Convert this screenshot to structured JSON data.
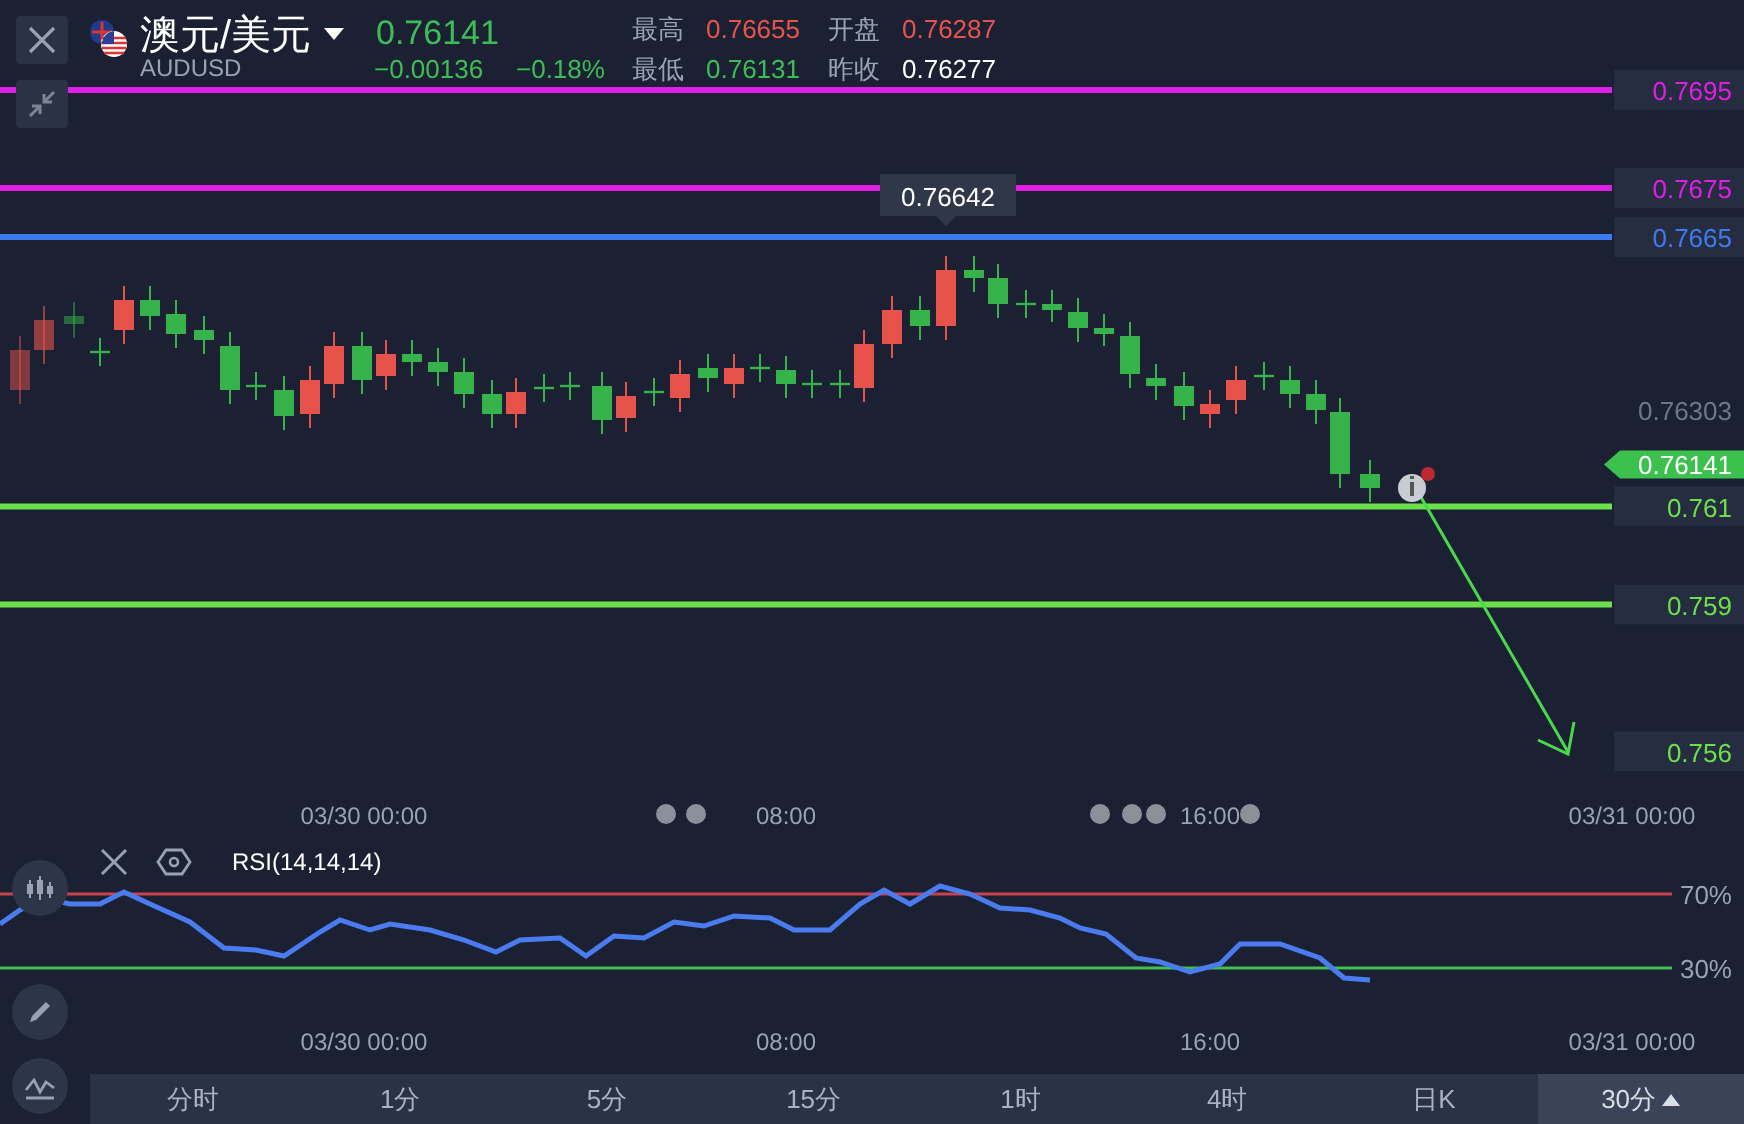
{
  "header": {
    "symbol_name": "澳元/美元",
    "symbol_code": "AUDUSD",
    "price": "0.76141",
    "color": "#3dbd55",
    "change": "−0.00136",
    "change_percent": "−0.18%",
    "stats": [
      {
        "label": "最高",
        "value": "0.76655",
        "color": "#e8544b"
      },
      {
        "label": "开盘",
        "value": "0.76287",
        "color": "#e8544b"
      },
      {
        "label": "最低",
        "value": "0.76131",
        "color": "#3dbd55"
      },
      {
        "label": "昨收",
        "value": "0.76277",
        "color": "#ffffff"
      }
    ]
  },
  "chart": {
    "levels": [
      {
        "kind": "line",
        "label": "0.7695",
        "color": "#e01ee6"
      },
      {
        "kind": "line",
        "label": "0.7675",
        "color": "#e01ee6"
      },
      {
        "kind": "line",
        "label": "0.7665",
        "color": "#3d7bf0"
      },
      {
        "kind": "line",
        "label": "0.761",
        "color": "#6be04a"
      },
      {
        "kind": "line",
        "label": "0.759",
        "color": "#6be04a"
      },
      {
        "kind": "target",
        "label": "0.756",
        "color": "#6be04a"
      }
    ],
    "axis_label": "0.76303",
    "current_price": "0.76141",
    "high_marker": "0.76642",
    "time_labels": [
      "03/30 00:00",
      "08:00",
      "16:00",
      "03/31 00:00"
    ]
  },
  "rsi": {
    "title": "RSI(14,14,14)",
    "bands": [
      {
        "label": "70%",
        "color": "#c9434f"
      },
      {
        "label": "30%",
        "color": "#3fbf4f"
      }
    ],
    "time_labels": [
      "03/30 00:00",
      "08:00",
      "16:00",
      "03/31 00:00"
    ]
  },
  "timeframes": [
    {
      "label": "分时",
      "selected": false
    },
    {
      "label": "1分",
      "selected": false
    },
    {
      "label": "5分",
      "selected": false
    },
    {
      "label": "15分",
      "selected": false
    },
    {
      "label": "1时",
      "selected": false
    },
    {
      "label": "4时",
      "selected": false
    },
    {
      "label": "日K",
      "selected": false
    },
    {
      "label": "30分",
      "selected": true
    }
  ]
}
